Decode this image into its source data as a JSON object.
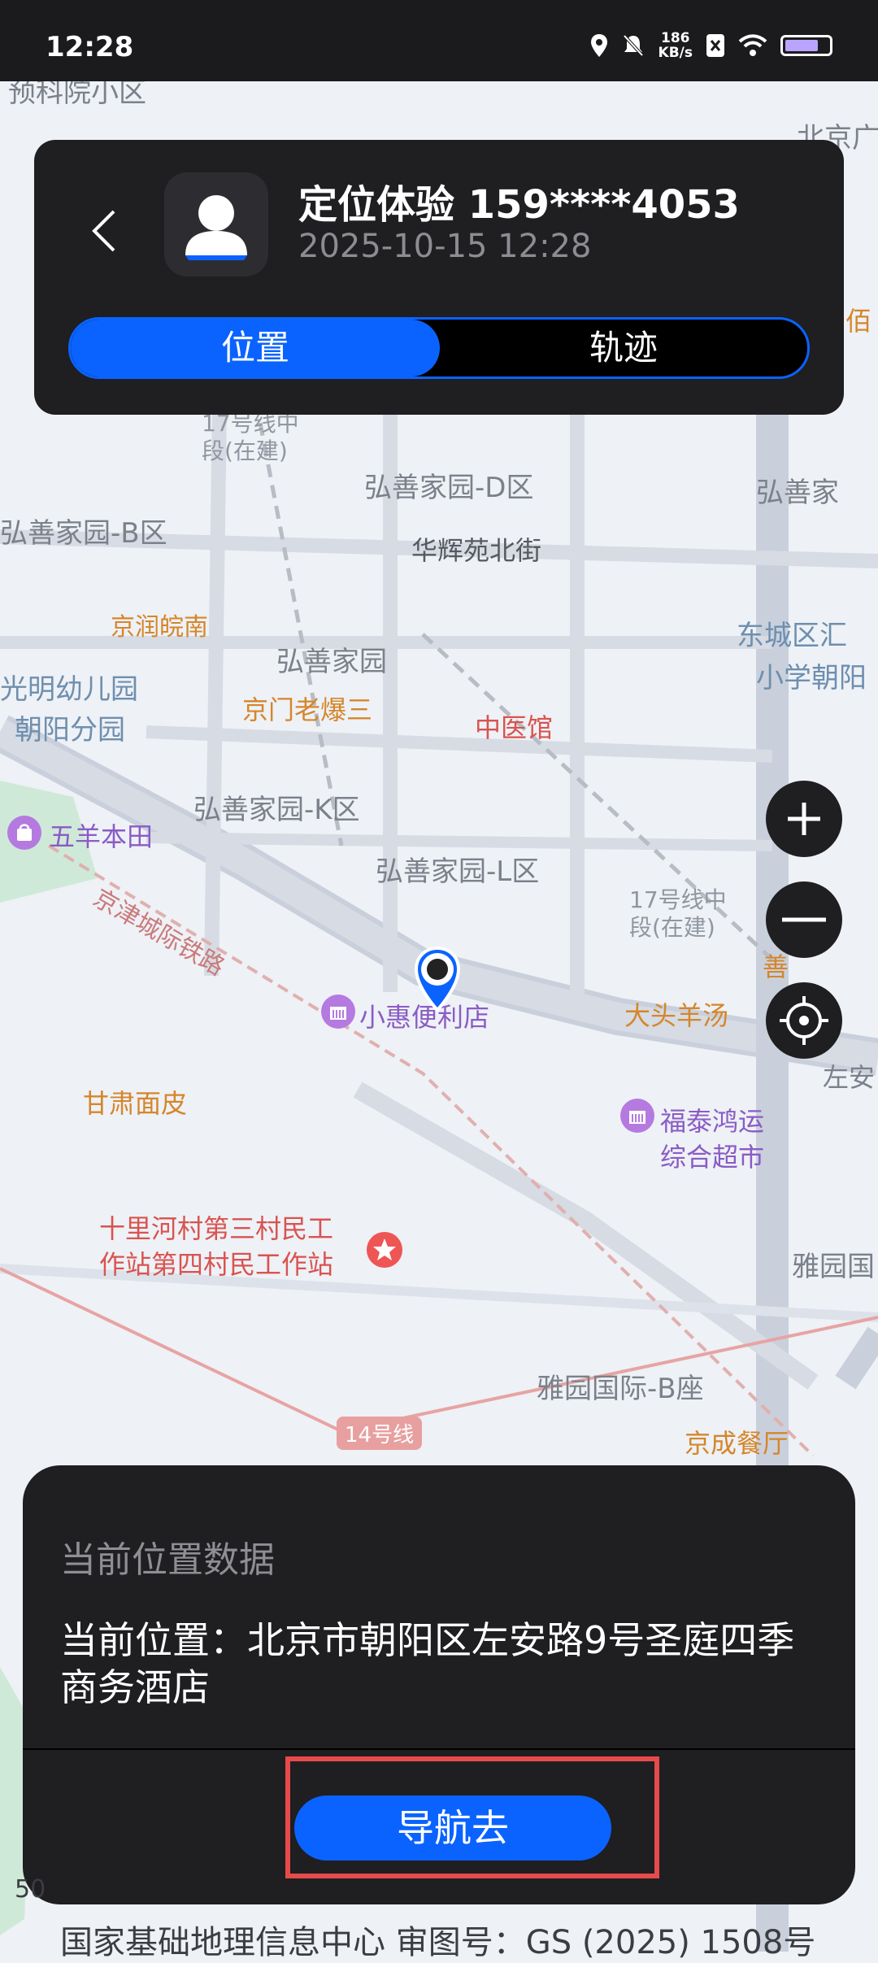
{
  "status_bar": {
    "time": "12:28",
    "net_speed_value": "186",
    "net_speed_unit": "KB/s"
  },
  "header": {
    "title": "定位体验 159****4053",
    "timestamp": "2025-10-15 12:28",
    "tabs": [
      {
        "label": "位置",
        "active": true
      },
      {
        "label": "轨迹",
        "active": false
      }
    ]
  },
  "map": {
    "labels": {
      "yuke": "预科院小区",
      "bj_guang": "北京广",
      "hs_d": "弘善家园-D区",
      "hs_b": "弘善家园-B区",
      "huahui": "华辉苑北街",
      "hs_rr": "弘善家",
      "jingrun": "京润皖南",
      "hs": "弘善家园",
      "dongcheng": "东城区汇",
      "chaoyang_school": "小学朝阳",
      "guangming": "光明幼儿园",
      "chaoyang_branch": "朝阳分园",
      "jingmen": "京门老爆三",
      "zhongyiguan": "中医馆",
      "wuyang": "五羊本田",
      "hs_k": "弘善家园-K区",
      "hs_l": "弘善家园-L区",
      "metro17_top_a": "17号线中",
      "metro17_top_b": "段(在建)",
      "metro17_mid_a": "17号线中",
      "metro17_mid_b": "段(在建)",
      "rail": "京津城际铁路",
      "xiaohui": "小惠便利店",
      "datou": "大头羊汤",
      "zuoan": "左安",
      "gansu": "甘肃面皮",
      "futai_a": "福泰鸿运",
      "futai_b": "综合超市",
      "shilihe_a": "十里河村第三村民工",
      "shilihe_b": "作站第四村民工作站",
      "yayuan": "雅园国",
      "yayuan_b": "雅园国际-B座",
      "line14": "14号线",
      "jingcheng": "京成餐厅",
      "shan": "善",
      "bai": "佰"
    }
  },
  "info_card": {
    "title": "当前位置数据",
    "address": "当前位置：北京市朝阳区左安路9号圣庭四季商务酒店",
    "nav_button": "导航去"
  },
  "footer": {
    "attribution": "国家基础地理信息中心  审图号：GS (2025) 1508号",
    "scale": "50"
  },
  "colors": {
    "accent": "#0a63ff",
    "card_bg": "#1f1e21",
    "highlight": "#e64b4b"
  }
}
